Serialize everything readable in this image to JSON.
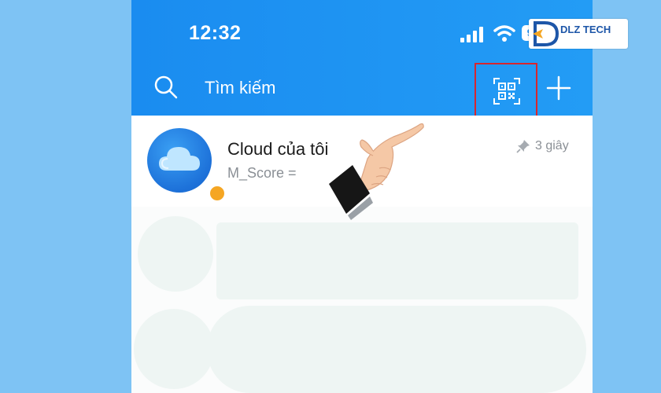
{
  "status_bar": {
    "time": "12:32",
    "battery": "98"
  },
  "header": {
    "search_label": "Tìm kiếm",
    "qr_icon": "qr-scan-icon",
    "add_icon": "plus-icon"
  },
  "chat": {
    "title": "Cloud của tôi",
    "subtitle": "M_Score =",
    "time": "3 giây",
    "pinned": true
  },
  "watermark": {
    "brand": "DLZ TECH"
  },
  "colors": {
    "header_blue": "#1a8cf0",
    "highlight_red": "#d7262e",
    "background_blue": "#7ec3f4",
    "badge_orange": "#f5a623"
  }
}
